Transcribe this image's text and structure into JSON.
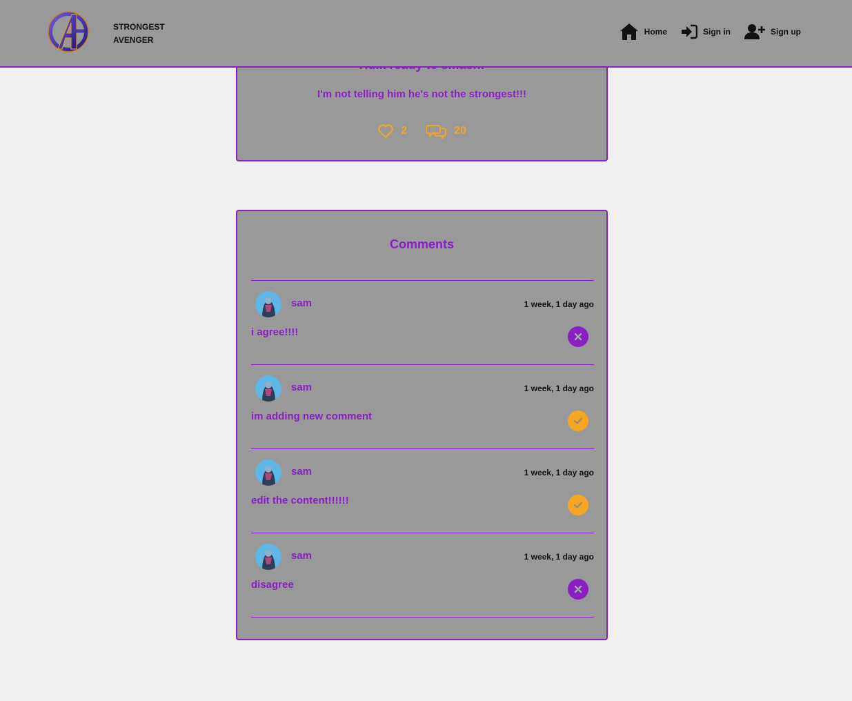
{
  "header": {
    "brand_line1": "STRONGEST",
    "brand_line2": "AVENGER",
    "nav": [
      {
        "label": "Home",
        "icon": "home-icon"
      },
      {
        "label": "Sign in",
        "icon": "sign-in-icon"
      },
      {
        "label": "Sign up",
        "icon": "user-plus-icon"
      }
    ]
  },
  "post": {
    "title": "Hulk ready to smash!",
    "body": "I'm not telling him he's not the strongest!!!",
    "likes": "2",
    "comments_count": "20"
  },
  "comments": {
    "title": "Comments",
    "items": [
      {
        "author": "sam",
        "time": "1 week, 1 day ago",
        "content": "i agree!!!!",
        "action": "delete"
      },
      {
        "author": "sam",
        "time": "1 week, 1 day ago",
        "content": "im adding new comment",
        "action": "edit"
      },
      {
        "author": "sam",
        "time": "1 week, 1 day ago",
        "content": "edit the content!!!!!!",
        "action": "edit"
      },
      {
        "author": "sam",
        "time": "1 week, 1 day ago",
        "content": "disagree",
        "action": "delete"
      }
    ]
  },
  "colors": {
    "accent": "#8a1fc4",
    "highlight": "#f6a623",
    "card_bg": "#999999",
    "page_bg": "#f0f0f0"
  }
}
